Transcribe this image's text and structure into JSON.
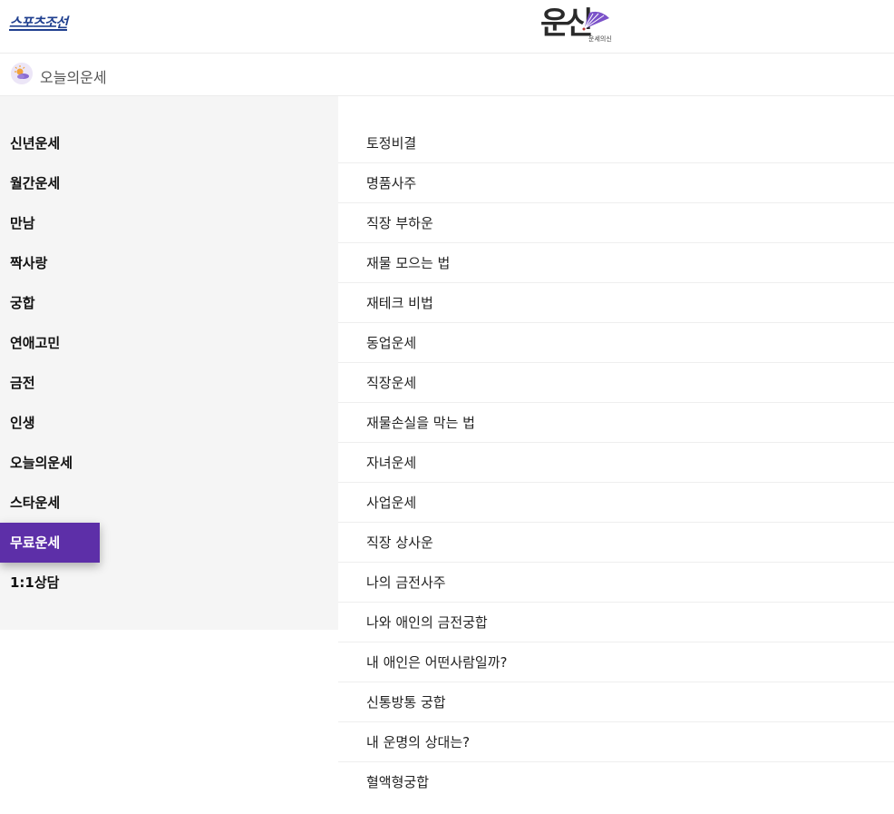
{
  "header": {
    "brand": "스포츠조선",
    "logo_main": "운신",
    "logo_sub": "운세의신"
  },
  "subheader": {
    "icon": "fortune-sun-cloud-icon",
    "title": "오늘의운세"
  },
  "sidebar": {
    "items": [
      {
        "label": "신년운세"
      },
      {
        "label": "월간운세"
      },
      {
        "label": "만남"
      },
      {
        "label": "짝사랑"
      },
      {
        "label": "궁합"
      },
      {
        "label": "연애고민"
      },
      {
        "label": "금전"
      },
      {
        "label": "인생"
      },
      {
        "label": "오늘의운세"
      },
      {
        "label": "스타운세"
      },
      {
        "label": "무료운세",
        "active": true
      },
      {
        "label": "1:1상담"
      }
    ],
    "active_color": "#5d2fa8"
  },
  "content": {
    "items": [
      {
        "label": "토정비결"
      },
      {
        "label": "명품사주"
      },
      {
        "label": "직장 부하운"
      },
      {
        "label": "재물 모으는 법"
      },
      {
        "label": "재테크 비법"
      },
      {
        "label": "동업운세"
      },
      {
        "label": "직장운세"
      },
      {
        "label": "재물손실을 막는 법"
      },
      {
        "label": "자녀운세"
      },
      {
        "label": "사업운세"
      },
      {
        "label": "직장 상사운"
      },
      {
        "label": "나의 금전사주"
      },
      {
        "label": "나와 애인의 금전궁합"
      },
      {
        "label": "내 애인은 어떤사람일까?"
      },
      {
        "label": "신통방통 궁합"
      },
      {
        "label": "내 운명의 상대는?"
      },
      {
        "label": "혈액형궁합"
      }
    ]
  }
}
